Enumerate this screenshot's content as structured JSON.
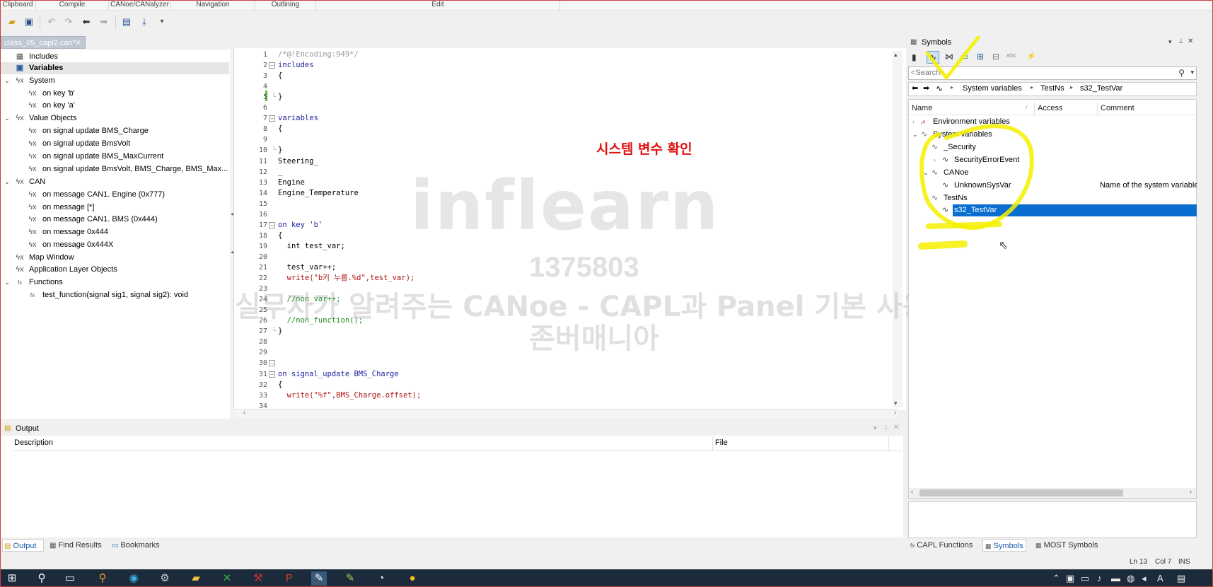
{
  "ribbon": {
    "groups": [
      "Clipboard",
      "Compile",
      "CANoe/CANalyzer",
      "Navigation",
      "Outlining",
      "Edit"
    ]
  },
  "doc_tab": {
    "title": "class_05_capl2.can*",
    "close": "✕"
  },
  "tree": {
    "items": [
      {
        "label": "Includes"
      },
      {
        "label": "Variables"
      },
      {
        "label": "System"
      },
      {
        "label": "on key 'b'"
      },
      {
        "label": "on key 'a'"
      },
      {
        "label": "Value Objects"
      },
      {
        "label": "on signal update BMS_Charge"
      },
      {
        "label": "on signal update BmsVolt"
      },
      {
        "label": "on signal update BMS_MaxCurrent"
      },
      {
        "label": "on signal update BmsVolt,  BMS_Charge,  BMS_Max..."
      },
      {
        "label": "CAN"
      },
      {
        "label": "on message CAN1. Engine (0x777)"
      },
      {
        "label": "on message [*]"
      },
      {
        "label": "on message CAN1. BMS (0x444)"
      },
      {
        "label": "on message 0x444"
      },
      {
        "label": "on message 0x444X"
      },
      {
        "label": "Map Window"
      },
      {
        "label": "Application Layer Objects"
      },
      {
        "label": "Functions"
      },
      {
        "label": "test_function(signal sig1, signal sig2): void"
      }
    ]
  },
  "editor": {
    "lines": [
      {
        "n": "1",
        "text": "/*@!Encoding:949*/"
      },
      {
        "n": "2",
        "text": "includes"
      },
      {
        "n": "3",
        "text": "{"
      },
      {
        "n": "4",
        "text": ""
      },
      {
        "n": "5",
        "text": "}"
      },
      {
        "n": "6",
        "text": ""
      },
      {
        "n": "7",
        "text": "variables"
      },
      {
        "n": "8",
        "text": "{"
      },
      {
        "n": "9",
        "text": ""
      },
      {
        "n": "10",
        "text": "}"
      },
      {
        "n": "11",
        "text": "Steering_"
      },
      {
        "n": "12",
        "text": "_"
      },
      {
        "n": "13",
        "text": "Engine"
      },
      {
        "n": "14",
        "text": "Engine_Temperature"
      },
      {
        "n": "15",
        "text": ""
      },
      {
        "n": "16",
        "text": ""
      },
      {
        "n": "17",
        "text": "on key 'b'"
      },
      {
        "n": "18",
        "text": "{"
      },
      {
        "n": "19",
        "text": "  int test_var;"
      },
      {
        "n": "20",
        "text": ""
      },
      {
        "n": "21",
        "text": "  test_var++;"
      },
      {
        "n": "22",
        "text": "  write(\"b키 누름.%d\",test_var);"
      },
      {
        "n": "23",
        "text": ""
      },
      {
        "n": "24",
        "text": "  //non_var++;"
      },
      {
        "n": "25",
        "text": ""
      },
      {
        "n": "26",
        "text": "  //non_function();"
      },
      {
        "n": "27",
        "text": "}"
      },
      {
        "n": "28",
        "text": ""
      },
      {
        "n": "29",
        "text": ""
      },
      {
        "n": "30",
        "text": ""
      },
      {
        "n": "31",
        "text": "on signal_update BMS_Charge"
      },
      {
        "n": "32",
        "text": "{"
      },
      {
        "n": "33",
        "text": "  write(\"%f\",BMS_Charge.offset);"
      },
      {
        "n": "34",
        "text": ""
      }
    ]
  },
  "annotation_text": "시스템 변수 확인",
  "watermark": {
    "logo": "inflearn",
    "id": "1375803",
    "course": "실무자가 알려주는 CANoe - CAPL과 Panel 기본 사용법",
    "author": "존버매니아"
  },
  "output": {
    "title": "Output",
    "col_description": "Description",
    "col_file": "File"
  },
  "bottom_tabs": [
    "Output",
    "Find Results",
    "Bookmarks"
  ],
  "symbols": {
    "title": "Symbols",
    "search_placeholder": "<Search>",
    "breadcrumb": [
      "System variables",
      "TestNs",
      "s32_TestVar"
    ],
    "columns": {
      "name": "Name",
      "access": "Access",
      "comment": "Comment"
    },
    "tree": [
      {
        "label": "Environment variables"
      },
      {
        "label": "System variables"
      },
      {
        "label": "_Security"
      },
      {
        "label": "SecurityErrorEvent"
      },
      {
        "label": "CANoe"
      },
      {
        "label": "UnknownSysVar",
        "comment": "Name of the system variable"
      },
      {
        "label": "TestNs"
      },
      {
        "label": "s32_TestVar"
      }
    ],
    "tabs": [
      "CAPL Functions",
      "Symbols",
      "MOST Symbols"
    ]
  },
  "status": {
    "ln": "Ln 13",
    "col": "Col 7",
    "mode": "INS"
  },
  "colors": {
    "selection": "#0a6ed1",
    "annotation": "#e01010",
    "highlighter": "#f5f000"
  }
}
